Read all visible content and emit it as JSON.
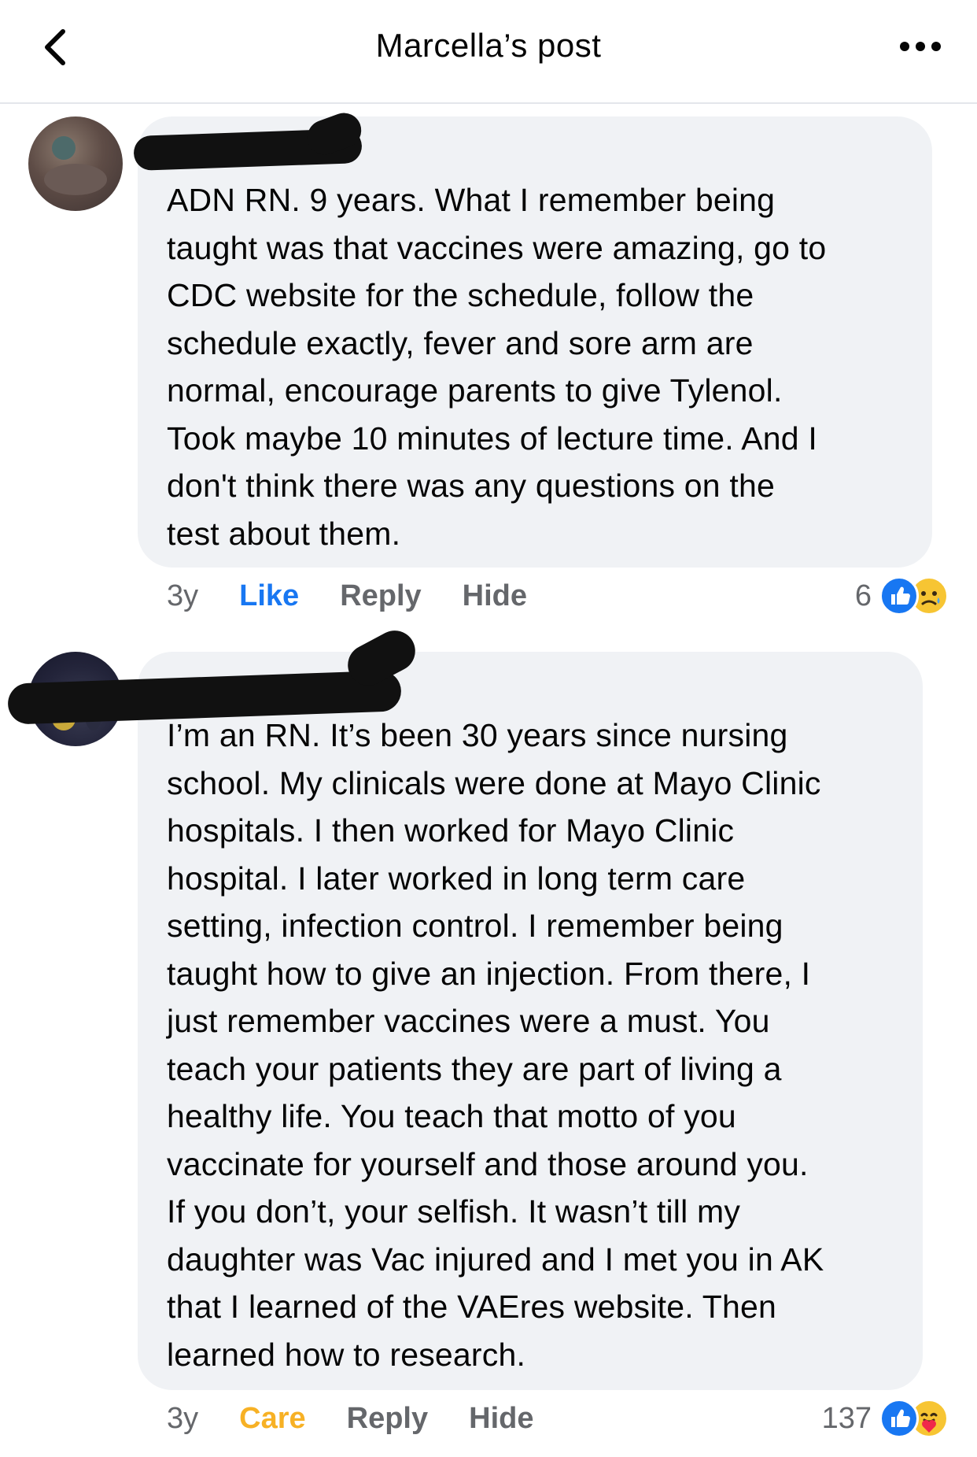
{
  "header": {
    "title": "Marcella’s post",
    "back_icon": "chevron-left-icon",
    "more_icon": "more-horizontal-icon"
  },
  "comments": [
    {
      "text": "ADN RN. 9 years. What I remember being\ntaught was that vaccines were amazing, go to\nCDC website for the schedule, follow the\nschedule exactly, fever and sore arm are\nnormal, encourage parents to give Tylenol.\nTook maybe 10 minutes of lecture time. And I\ndon't think there was any questions on the\ntest about them.",
      "time": "3y",
      "reaction_action": "Like",
      "reply": "Reply",
      "hide": "Hide",
      "reaction_count": "6",
      "reaction_icons": [
        "like-icon",
        "sad-icon"
      ]
    },
    {
      "text": "I’m an RN.  It’s been 30 years since nursing\nschool. My clinicals were done at Mayo Clinic\nhospitals. I then worked for Mayo Clinic\nhospital.  I later worked in long term care\nsetting, infection control.  I remember being\ntaught how to give an injection. From there, I\njust remember vaccines were a must. You\nteach your patients they are part of living a\nhealthy life.  You teach that motto of you\nvaccinate for yourself and those around you.\nIf you don’t, your selfish. It wasn’t till my\ndaughter was Vac injured and I met you in AK\nthat I learned of the VAEres website. Then\nlearned how to research.",
      "time": "3y",
      "reaction_action": "Care",
      "reply": "Reply",
      "hide": "Hide",
      "reaction_count": "137",
      "reaction_icons": [
        "like-icon",
        "care-icon"
      ]
    }
  ],
  "colors": {
    "like_blue": "#1877f2",
    "care_yellow": "#f7b125",
    "bubble_bg": "#f0f2f5",
    "meta_gray": "#65676b"
  }
}
